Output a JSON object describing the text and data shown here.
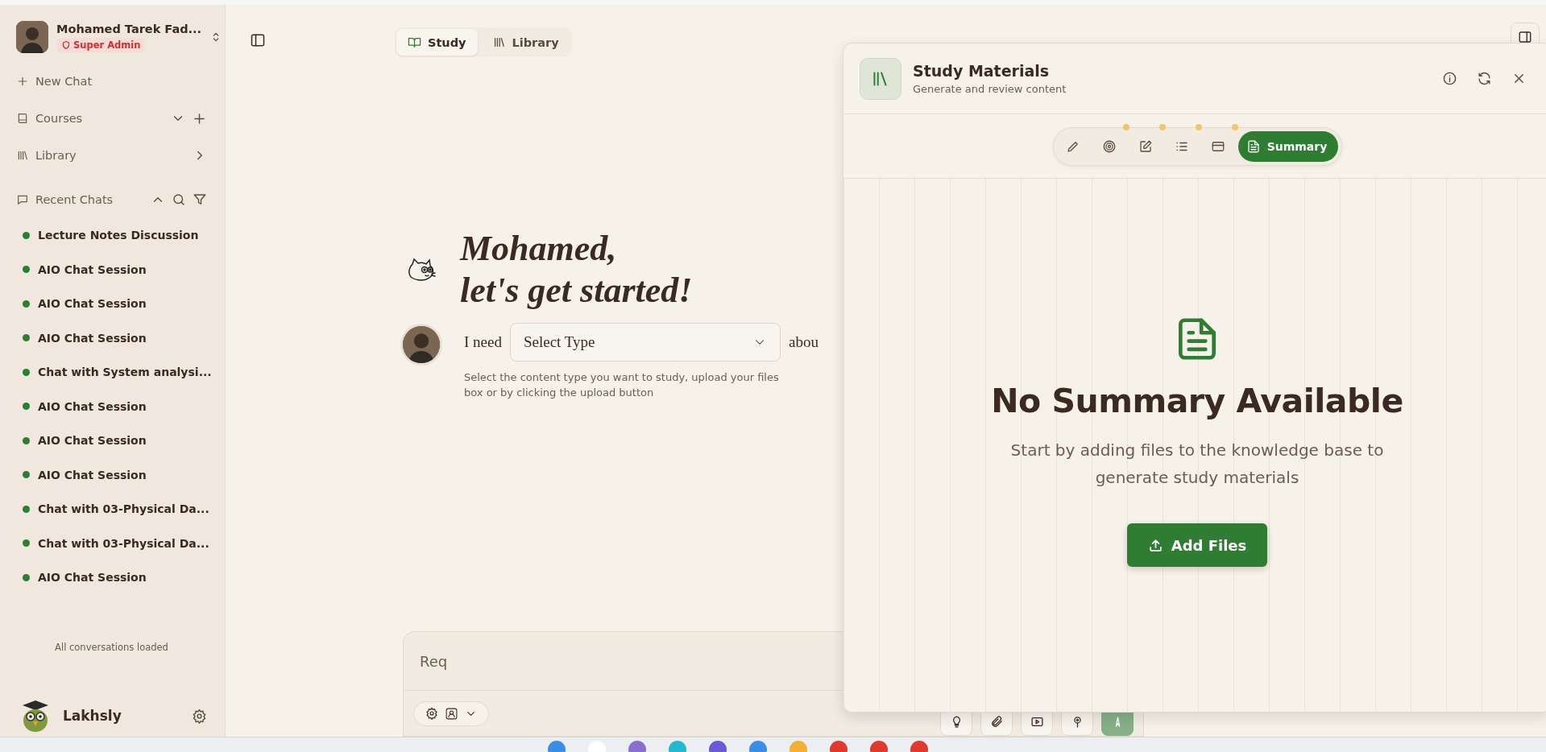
{
  "sidebar": {
    "user": {
      "name": "Mohamed Tarek Fad...",
      "role": "Super Admin"
    },
    "nav": [
      {
        "kind": "new",
        "label": "New Chat"
      },
      {
        "kind": "courses",
        "label": "Courses"
      },
      {
        "kind": "library",
        "label": "Library"
      }
    ],
    "recent": {
      "title": "Recent Chats",
      "expanded": true,
      "items": [
        {
          "title": "Lecture Notes Discussion",
          "color": "#2e7d32"
        },
        {
          "title": "AIO Chat Session",
          "color": "#2e7d32"
        },
        {
          "title": "AIO Chat Session",
          "color": "#2e7d32"
        },
        {
          "title": "AIO Chat Session",
          "color": "#2e7d32"
        },
        {
          "title": "Chat with System analysi...",
          "color": "#2e7d32"
        },
        {
          "title": "AIO Chat Session",
          "color": "#2e7d32"
        },
        {
          "title": "AIO Chat Session",
          "color": "#2e7d32"
        },
        {
          "title": "AIO Chat Session",
          "color": "#2e7d32"
        },
        {
          "title": "Chat with 03-Physical Da...",
          "color": "#2e7d32"
        },
        {
          "title": "Chat with 03-Physical Da...",
          "color": "#2e7d32"
        },
        {
          "title": "AIO Chat Session",
          "color": "#2e7d32"
        }
      ]
    },
    "footer_note": "All conversations loaded",
    "assistant": {
      "name": "Lakhsly"
    }
  },
  "main": {
    "tabs": [
      {
        "kind": "study",
        "label": "Study",
        "selected": true
      },
      {
        "kind": "library",
        "label": "Library",
        "selected": false
      }
    ],
    "greeting": [
      "Mohamed,",
      "let's get started!"
    ],
    "prompt": {
      "prefix": "I need",
      "select": {
        "placeholder": "Select Type"
      },
      "suffix": "abou",
      "help": [
        "Select the content type you want to study, upload your files",
        "box or by clicking the upload button"
      ]
    },
    "composer": {
      "placeholder": "Req",
      "tools": [
        {
          "kind": "bulb"
        },
        {
          "kind": "clip"
        },
        {
          "kind": "video"
        },
        {
          "kind": "mic"
        },
        {
          "kind": "send"
        }
      ]
    }
  },
  "panel": {
    "title": "Study Materials",
    "subtitle": "Generate and review content",
    "tools": [
      {
        "kind": "pencil",
        "selected": false
      },
      {
        "kind": "target",
        "selected": false,
        "badge": true
      },
      {
        "kind": "edit",
        "selected": false,
        "badge": true
      },
      {
        "kind": "list",
        "selected": false,
        "badge": true
      },
      {
        "kind": "card",
        "selected": false,
        "badge": true
      },
      {
        "kind": "summary",
        "label": "Summary",
        "selected": true
      }
    ],
    "empty": {
      "title": "No Summary Available",
      "text": [
        "Start by adding files to the knowledge base to",
        "generate study materials"
      ],
      "button": "Add Files"
    }
  }
}
